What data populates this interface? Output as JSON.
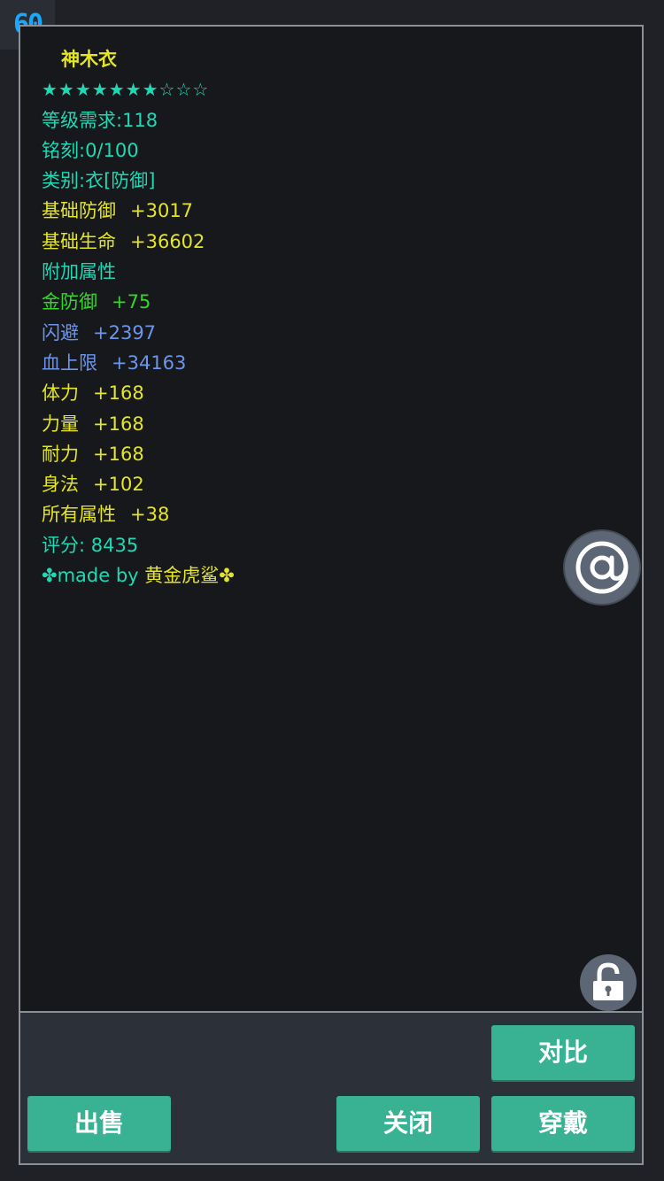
{
  "fps": "60",
  "item": {
    "name": "神木衣",
    "stars": "★★★★★★★☆☆☆",
    "level_req": "等级需求:118",
    "inscription": "铭刻:0/100",
    "category": "类别:衣[防御]",
    "base_stats": [
      {
        "label": "基础防御",
        "value": "+3017"
      },
      {
        "label": "基础生命",
        "value": "+36602"
      }
    ],
    "extra_header": "附加属性",
    "extra_stats": [
      {
        "label": "金防御",
        "value": "+75",
        "color": "#34d62a"
      },
      {
        "label": "闪避",
        "value": "+2397",
        "color": "#6d95ea"
      },
      {
        "label": "血上限",
        "value": "+34163",
        "color": "#6d95ea"
      },
      {
        "label": "体力",
        "value": "+168",
        "color": "#e4e526"
      },
      {
        "label": "力量",
        "value": "+168",
        "color": "#e4e526"
      },
      {
        "label": "耐力",
        "value": "+168",
        "color": "#e4e526"
      },
      {
        "label": "身法",
        "value": "+102",
        "color": "#e4e526"
      },
      {
        "label": "所有属性",
        "value": "+38",
        "color": "#e4e526"
      }
    ],
    "score": "评分: 8435",
    "made_by_prefix": "✤made by ",
    "made_by_name": "黄金虎鲨✤"
  },
  "colors": {
    "yellow": "#e4e526",
    "teal": "#1fd8b4",
    "green": "#34d62a",
    "blue": "#6d95ea",
    "button": "#38b293"
  },
  "icons": {
    "float": "at-sign-icon",
    "lock": "unlock-icon"
  },
  "buttons": {
    "compare": "对比",
    "sell": "出售",
    "close": "关闭",
    "equip": "穿戴"
  }
}
